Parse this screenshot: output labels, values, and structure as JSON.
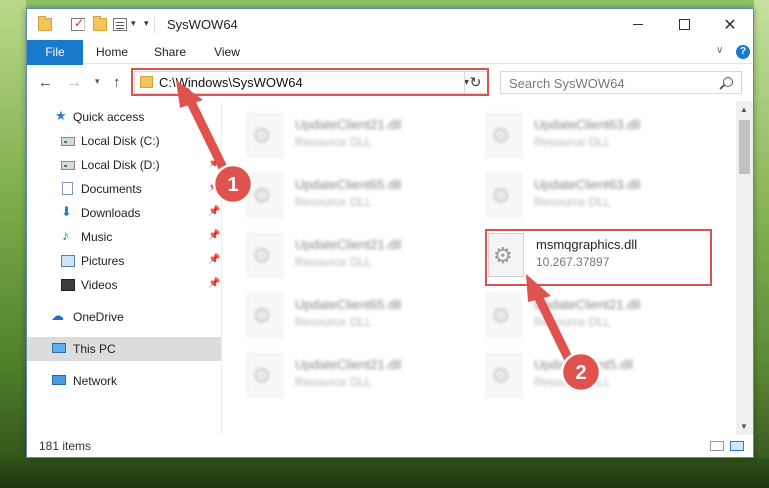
{
  "window": {
    "title": "SysWOW64"
  },
  "ribbon": {
    "tabs": [
      {
        "label": "File"
      },
      {
        "label": "Home"
      },
      {
        "label": "Share"
      },
      {
        "label": "View"
      }
    ]
  },
  "navigation": {
    "address_path": "C:\\Windows\\SysWOW64",
    "search_placeholder": "Search SysWOW64"
  },
  "sidebar": {
    "items": [
      {
        "label": "Quick access",
        "icon": "star-icon"
      },
      {
        "label": "Local Disk (C:)",
        "icon": "drive-icon"
      },
      {
        "label": "Local Disk (D:)",
        "icon": "drive-icon",
        "pinned": true
      },
      {
        "label": "Documents",
        "icon": "documents-icon",
        "pinned": true
      },
      {
        "label": "Downloads",
        "icon": "download-icon",
        "pinned": true
      },
      {
        "label": "Music",
        "icon": "music-icon",
        "pinned": true
      },
      {
        "label": "Pictures",
        "icon": "pictures-icon",
        "pinned": true
      },
      {
        "label": "Videos",
        "icon": "videos-icon",
        "pinned": true
      },
      {
        "label": "OneDrive",
        "icon": "cloud-icon"
      },
      {
        "label": "This PC",
        "icon": "computer-icon",
        "selected": true
      },
      {
        "label": "Network",
        "icon": "network-icon"
      }
    ]
  },
  "files": [
    {
      "name": "UpdateClient21.dll",
      "desc": "Resource DLL",
      "blurred": true
    },
    {
      "name": "UpdateClient63.dll",
      "desc": "Resource DLL",
      "blurred": true
    },
    {
      "name": "UpdateClient65.dll",
      "desc": "Resource DLL",
      "blurred": true
    },
    {
      "name": "UpdateClient63.dll",
      "desc": "Resource DLL",
      "blurred": true
    },
    {
      "name": "UpdateClient21.dll",
      "desc": "Resource DLL",
      "blurred": true
    },
    {
      "name": "msmqgraphics.dll",
      "desc": "10.267.37897",
      "blurred": false,
      "highlighted": true
    },
    {
      "name": "UpdateClient65.dll",
      "desc": "Resource DLL",
      "blurred": true
    },
    {
      "name": "UpdateClient21.dll",
      "desc": "Resource DLL",
      "blurred": true
    },
    {
      "name": "UpdateClient21.dll",
      "desc": "Resource DLL",
      "blurred": true
    },
    {
      "name": "UpdateClient5.dll",
      "desc": "Resource DLL",
      "blurred": true
    }
  ],
  "status": {
    "item_count": "181 items"
  },
  "annotations": [
    {
      "label": "1"
    },
    {
      "label": "2"
    }
  ],
  "colors": {
    "accent": "#1979ca",
    "highlight": "#d9534f",
    "arrow": "#e0524e"
  }
}
